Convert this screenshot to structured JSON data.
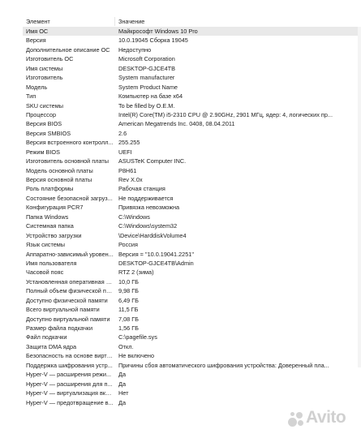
{
  "columns": {
    "element": "Элемент",
    "value": "Значение"
  },
  "rows": [
    {
      "key": "Имя ОС",
      "value": "Майкрософт Windows 10 Pro",
      "selected": true
    },
    {
      "key": "Версия",
      "value": "10.0.19045 Сборка 19045"
    },
    {
      "key": "Дополнительное описание ОС",
      "value": "Недоступно"
    },
    {
      "key": "Изготовитель ОС",
      "value": "Microsoft Corporation"
    },
    {
      "key": "Имя системы",
      "value": "DESKTOP-GJCE4TB"
    },
    {
      "key": "Изготовитель",
      "value": "System manufacturer"
    },
    {
      "key": "Модель",
      "value": "System Product Name"
    },
    {
      "key": "Тип",
      "value": "Компьютер на базе x64"
    },
    {
      "key": "SKU системы",
      "value": "To be filled by O.E.M."
    },
    {
      "key": "Процессор",
      "value": "Intel(R) Core(TM) i5-2310 CPU @ 2.90GHz, 2901 МГц, ядер: 4, логических пр..."
    },
    {
      "key": "Версия BIOS",
      "value": "American Megatrends Inc. 0408, 08.04.2011"
    },
    {
      "key": "Версия SMBIOS",
      "value": "2.6"
    },
    {
      "key": "Версия встроенного контролл...",
      "value": "255.255"
    },
    {
      "key": "Режим BIOS",
      "value": "UEFI"
    },
    {
      "key": "Изготовитель основной платы",
      "value": "ASUSTeK Computer INC."
    },
    {
      "key": "Модель основной платы",
      "value": "P8H61"
    },
    {
      "key": "Версия основной платы",
      "value": "Rev X.0x"
    },
    {
      "key": "Роль платформы",
      "value": "Рабочая станция"
    },
    {
      "key": "Состояние безопасной загруз...",
      "value": "Не поддерживается"
    },
    {
      "key": "Конфигурация PCR7",
      "value": "Привязка невозможна"
    },
    {
      "key": "Папка Windows",
      "value": "C:\\Windows"
    },
    {
      "key": "Системная папка",
      "value": "C:\\Windows\\system32"
    },
    {
      "key": "Устройство загрузки",
      "value": "\\Device\\HarddiskVolume4"
    },
    {
      "key": "Язык системы",
      "value": "Россия"
    },
    {
      "key": "Аппаратно-зависимый уровен...",
      "value": "Версия = \"10.0.19041.2251\""
    },
    {
      "key": "Имя пользователя",
      "value": "DESKTOP-GJCE4TB\\Admin"
    },
    {
      "key": "Часовой пояс",
      "value": "RTZ 2 (зима)"
    },
    {
      "key": "Установленная оперативная п...",
      "value": "10,0 ГБ"
    },
    {
      "key": "Полный объем физической па...",
      "value": "9,98 ГБ"
    },
    {
      "key": "Доступно физической памяти",
      "value": "6,49 ГБ"
    },
    {
      "key": "Всего виртуальной памяти",
      "value": "11,5 ГБ"
    },
    {
      "key": "Доступно виртуальной памяти",
      "value": "7,08 ГБ"
    },
    {
      "key": "Размер файла подкачки",
      "value": "1,56 ГБ"
    },
    {
      "key": "Файл подкачки",
      "value": "C:\\pagefile.sys"
    },
    {
      "key": "Защита DMA ядра",
      "value": "Откл."
    },
    {
      "key": "Безопасность на основе вирту...",
      "value": "Не включено"
    },
    {
      "key": "Поддержка шифрования устр...",
      "value": "Причины сбоя автоматического шифрования устройства: Доверенный пла..."
    },
    {
      "key": "Hyper-V — расширения режи...",
      "value": "Да"
    },
    {
      "key": "Hyper-V — расширения для п...",
      "value": "Да"
    },
    {
      "key": "Hyper-V — виртуализация вкл...",
      "value": "Нет"
    },
    {
      "key": "Hyper-V — предотвращение в...",
      "value": "Да"
    }
  ],
  "watermark": {
    "text": "Avito"
  },
  "colors": {
    "selected_row": "#e9e9e9",
    "text": "#222222",
    "divider": "#e2e2e2",
    "watermark": "#aaaaaa"
  }
}
